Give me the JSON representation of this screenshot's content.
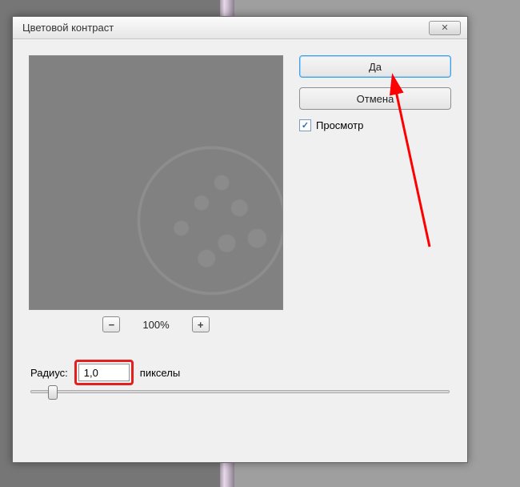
{
  "dialog": {
    "title": "Цветовой контраст",
    "close_symbol": "✕"
  },
  "buttons": {
    "ok": "Да",
    "cancel": "Отмена"
  },
  "preview_checkbox": {
    "label": "Просмотр",
    "checked_mark": "✓"
  },
  "zoom": {
    "minus": "−",
    "plus": "+",
    "level": "100%"
  },
  "radius": {
    "label": "Радиус:",
    "value": "1,0",
    "unit": "пикселы"
  }
}
